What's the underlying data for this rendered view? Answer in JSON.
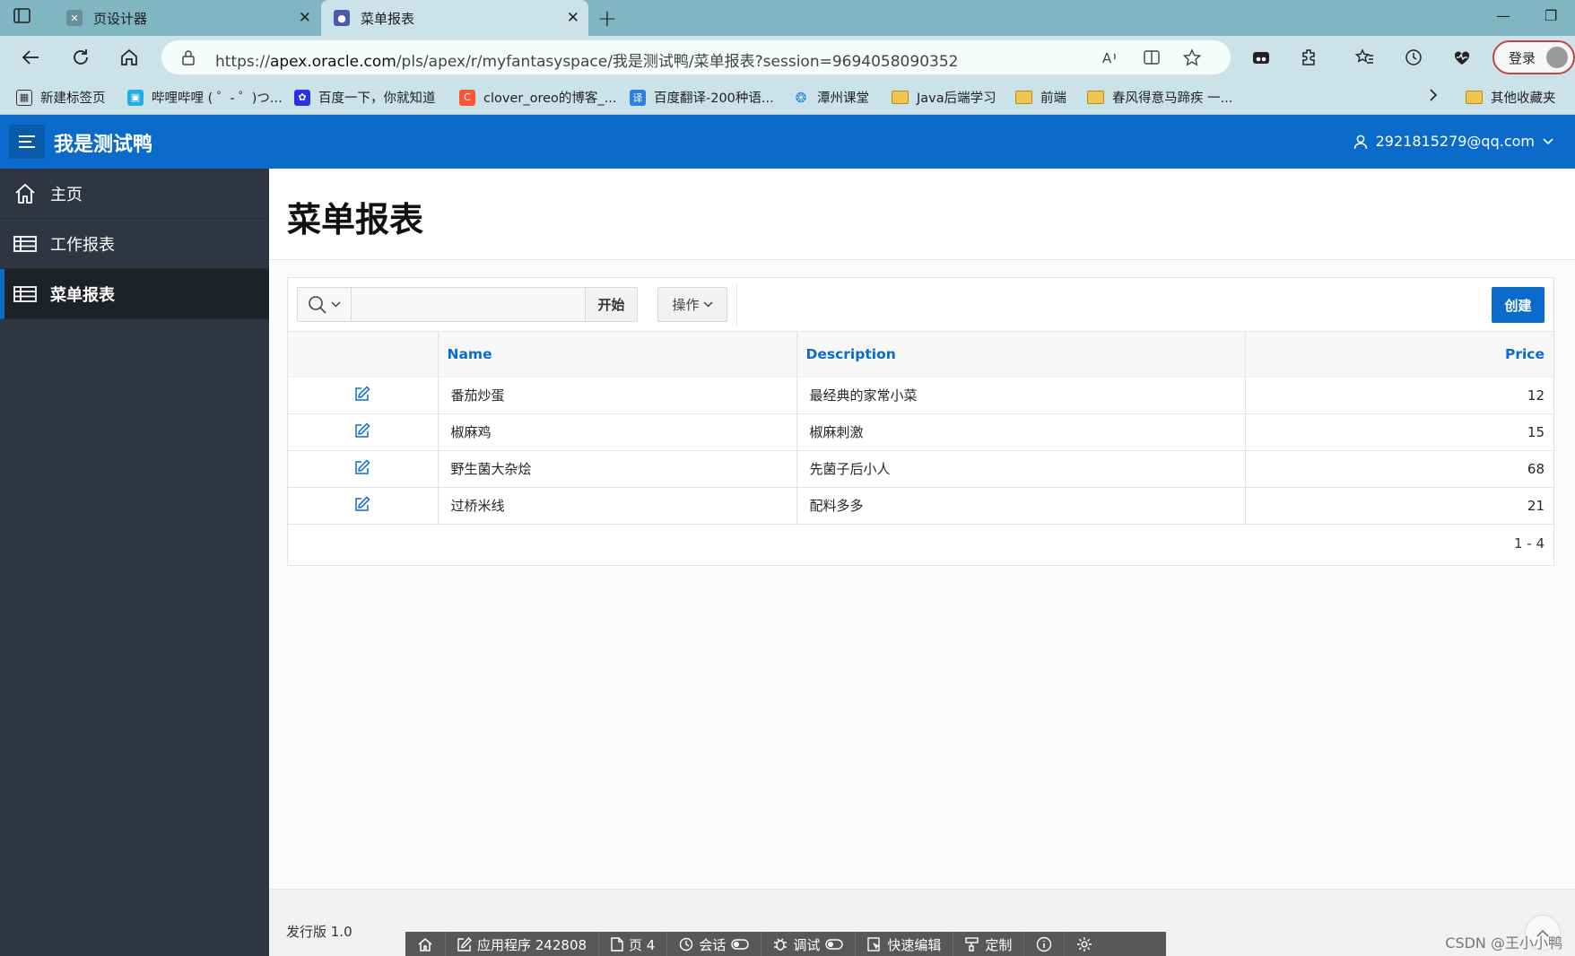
{
  "browser": {
    "tabs": [
      {
        "title": "页设计器",
        "active": false
      },
      {
        "title": "菜单报表",
        "active": true
      }
    ],
    "url_prefix": "https://",
    "url_host": "apex.oracle.com",
    "url_path": "/pls/apex/r/myfantasyspace/我是测试鸭/菜单报表?session=9694058090352",
    "login_label": "登录",
    "bookmarks": [
      "新建标签页",
      "哔哩哔哩 ( ゜- ゜)つ...",
      "百度一下，你就知道",
      "clover_oreo的博客_...",
      "百度翻译-200种语...",
      "潭州课堂",
      "Java后端学习",
      "前端",
      "春风得意马蹄疾 一...",
      "其他收藏夹"
    ]
  },
  "app": {
    "title": "我是测试鸭",
    "user": "2921815279@qq.com",
    "accent_color": "#0b6bcb",
    "sidebar": [
      {
        "label": "主页",
        "icon": "home-icon"
      },
      {
        "label": "工作报表",
        "icon": "table-icon"
      },
      {
        "label": "菜单报表",
        "icon": "table-icon",
        "active": true
      }
    ]
  },
  "page": {
    "title": "菜单报表",
    "toolbar": {
      "search_value": "",
      "go_label": "开始",
      "actions_label": "操作",
      "create_label": "创建"
    },
    "columns": [
      "",
      "Name",
      "Description",
      "Price"
    ],
    "rows": [
      {
        "name": "番茄炒蛋",
        "description": "最经典的家常小菜",
        "price": "12"
      },
      {
        "name": "椒麻鸡",
        "description": "椒麻刺激",
        "price": "15"
      },
      {
        "name": "野生菌大杂烩",
        "description": "先菌子后小人",
        "price": "68"
      },
      {
        "name": "过桥米线",
        "description": "配料多多",
        "price": "21"
      }
    ],
    "pagination": "1 - 4"
  },
  "footer": {
    "release": "发行版 1.0",
    "devbar": [
      {
        "label": "",
        "icon": "home-icon"
      },
      {
        "label": "应用程序 242808",
        "icon": "edit-icon"
      },
      {
        "label": "页 4",
        "icon": "page-icon"
      },
      {
        "label": "会话",
        "icon": "clock-icon"
      },
      {
        "label": "调试",
        "icon": "bug-icon"
      },
      {
        "label": "快速编辑",
        "icon": "quick-edit-icon"
      },
      {
        "label": "定制",
        "icon": "brush-icon"
      },
      {
        "label": "",
        "icon": "info-icon"
      },
      {
        "label": "",
        "icon": "gear-icon"
      }
    ]
  },
  "watermark": "CSDN @王小小鸭"
}
